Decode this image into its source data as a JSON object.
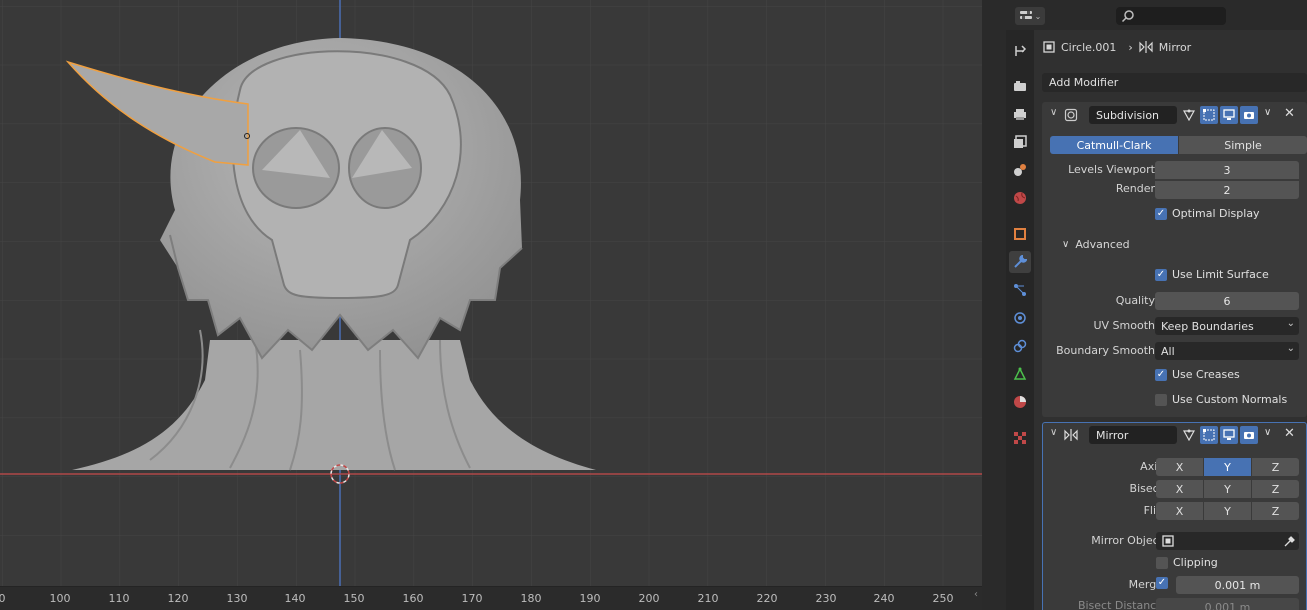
{
  "viewport": {
    "ruler_ticks": [
      "0",
      "100",
      "110",
      "120",
      "130",
      "140",
      "150",
      "160",
      "170",
      "180",
      "190",
      "200",
      "210",
      "220",
      "230",
      "240",
      "250"
    ]
  },
  "properties": {
    "breadcrumb": {
      "object": "Circle.001",
      "separator": "›",
      "modifier": "Mirror"
    },
    "add_modifier_label": "Add Modifier",
    "subdivision": {
      "name": "Subdivision",
      "type_options": [
        "Catmull-Clark",
        "Simple"
      ],
      "selected_type": "Catmull-Clark",
      "levels_viewport_label": "Levels Viewport",
      "levels_viewport": "3",
      "render_label": "Render",
      "render": "2",
      "optimal_display_label": "Optimal Display",
      "optimal_display": true,
      "advanced_label": "Advanced",
      "use_limit_surface_label": "Use Limit Surface",
      "use_limit_surface": true,
      "quality_label": "Quality",
      "quality": "6",
      "uv_smooth_label": "UV Smooth",
      "uv_smooth": "Keep Boundaries",
      "boundary_smooth_label": "Boundary Smooth",
      "boundary_smooth": "All",
      "use_creases_label": "Use Creases",
      "use_creases": true,
      "use_custom_normals_label": "Use Custom Normals",
      "use_custom_normals": false
    },
    "mirror": {
      "name": "Mirror",
      "axis_label": "Axis",
      "bisect_label": "Bisect",
      "flip_label": "Flip",
      "xyz": [
        "X",
        "Y",
        "Z"
      ],
      "axis_selected": "Y",
      "mirror_object_label": "Mirror Object",
      "clipping_label": "Clipping",
      "clipping": false,
      "merge_label": "Merge",
      "merge": true,
      "merge_value": "0.001 m",
      "bisect_distance_label": "Bisect Distance",
      "bisect_distance_value": "0.001 m"
    }
  },
  "colors": {
    "accent": "#4772b3",
    "selection_outline": "#f0a040",
    "x_axis": "#c04848",
    "z_axis": "#4a6fb5"
  },
  "icons": {
    "tabs": [
      "tool-icon",
      "render-icon",
      "output-icon",
      "view-layer-icon",
      "scene-icon",
      "world-icon",
      "object-icon",
      "modifier-wrench-icon",
      "particles-icon",
      "physics-icon",
      "constraints-icon",
      "data-icon",
      "material-icon",
      "texture-icon"
    ]
  }
}
